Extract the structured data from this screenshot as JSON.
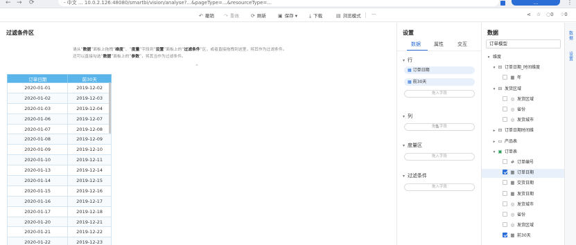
{
  "browser": {
    "address": "- 中文 ... 10.0.2.126:48080/smartbi/vision/analyse?...&pageType=...&resourceType=...",
    "account": "..."
  },
  "toolbar": {
    "undo": "撤销",
    "redo": "重做",
    "refresh": "刷新",
    "save": "保存",
    "download": "下载",
    "browse": "浏览模式",
    "more": "···",
    "comments": "0",
    "likes": "0"
  },
  "canvas": {
    "title": "过滤条件区",
    "hint_line1": {
      "p1": "请从“",
      "k1": "数据",
      "p2": "”面板上拖拽“",
      "k2": "维度",
      "p3": "”、“",
      "k3": "度量",
      "p4": "”字段到“",
      "k4": "设置",
      "p5": "”面板上的“",
      "k5": "过滤条件",
      "p6": "”区，或者直接拖拽到这里，将其作为过滤条件。"
    },
    "hint_line2": {
      "p1": "还可以直接勾选“",
      "k1": "数据",
      "p2": "”面板上的“",
      "k2": "参数",
      "p3": "”，将其当作为过滤条件。"
    }
  },
  "table": {
    "headers": [
      "订单日期",
      "前30天"
    ],
    "rows": [
      [
        "2020-01-01",
        "2019-12-02"
      ],
      [
        "2020-01-02",
        "2019-12-03"
      ],
      [
        "2020-01-03",
        "2019-12-04"
      ],
      [
        "2020-01-06",
        "2019-12-07"
      ],
      [
        "2020-01-07",
        "2019-12-08"
      ],
      [
        "2020-01-08",
        "2019-12-09"
      ],
      [
        "2020-01-09",
        "2019-12-10"
      ],
      [
        "2020-01-10",
        "2019-12-11"
      ],
      [
        "2020-01-13",
        "2019-12-14"
      ],
      [
        "2020-01-14",
        "2019-12-15"
      ],
      [
        "2020-01-15",
        "2019-12-16"
      ],
      [
        "2020-01-16",
        "2019-12-17"
      ],
      [
        "2020-01-17",
        "2019-12-18"
      ],
      [
        "2020-01-20",
        "2019-12-21"
      ],
      [
        "2020-01-21",
        "2019-12-22"
      ],
      [
        "2020-01-22",
        "2019-12-23"
      ]
    ]
  },
  "settings": {
    "title": "设置",
    "tabs": [
      "数据",
      "属性",
      "交互"
    ],
    "rows_section": "行",
    "row_chip_1": "订单日期",
    "row_chip_2": "前30天",
    "drop_hint": "拖入字段",
    "cols_section": "列",
    "measure_section": "度量区",
    "filter_section": "过滤条件"
  },
  "data": {
    "title": "数据",
    "model": "订单模型",
    "tree": [
      {
        "label": "维度",
        "level": 0,
        "arrow": "▾",
        "icon": "",
        "cb": "",
        "key": "dim"
      },
      {
        "label": "订单日期_时间维度",
        "level": 1,
        "arrow": "▾",
        "icon": "hier",
        "cb": "",
        "key": "t1"
      },
      {
        "label": "年",
        "level": 2,
        "arrow": "",
        "icon": "cal",
        "cb": "off",
        "key": "t2"
      },
      {
        "label": "发货区域",
        "level": 1,
        "arrow": "▾",
        "icon": "hier",
        "cb": "",
        "key": "t3"
      },
      {
        "label": "发货区域",
        "level": 2,
        "arrow": "",
        "icon": "globe",
        "cb": "off",
        "key": "t4"
      },
      {
        "label": "省份",
        "level": 2,
        "arrow": "",
        "icon": "globe",
        "cb": "off",
        "key": "t5"
      },
      {
        "label": "发货城市",
        "level": 2,
        "arrow": "",
        "icon": "globe",
        "cb": "off",
        "key": "t6"
      },
      {
        "label": "订单日期时间维",
        "level": 1,
        "arrow": "▸",
        "icon": "hier",
        "cb": "",
        "key": "t7"
      },
      {
        "label": "产品表",
        "level": 1,
        "arrow": "▸",
        "icon": "folder",
        "cb": "",
        "key": "t8"
      },
      {
        "label": "订单表",
        "level": 1,
        "arrow": "▾",
        "icon": "tableg",
        "cb": "",
        "key": "t9"
      },
      {
        "label": "订单编号",
        "level": 2,
        "arrow": "",
        "icon": "hash",
        "cb": "off",
        "key": "t10"
      },
      {
        "label": "订单日期",
        "level": 2,
        "arrow": "",
        "icon": "cal",
        "cb": "on",
        "key": "t11"
      },
      {
        "label": "交货日期",
        "level": 2,
        "arrow": "",
        "icon": "cal",
        "cb": "off",
        "key": "t12"
      },
      {
        "label": "发货日期",
        "level": 2,
        "arrow": "",
        "icon": "cal",
        "cb": "off",
        "key": "t13"
      },
      {
        "label": "发货城市",
        "level": 2,
        "arrow": "",
        "icon": "globe",
        "cb": "off",
        "key": "t14"
      },
      {
        "label": "省份",
        "level": 2,
        "arrow": "",
        "icon": "globe",
        "cb": "off",
        "key": "t15"
      },
      {
        "label": "发货区域",
        "level": 2,
        "arrow": "",
        "icon": "globe",
        "cb": "off",
        "key": "t16"
      },
      {
        "label": "前30天",
        "level": 2,
        "arrow": "",
        "icon": "calc",
        "cb": "on",
        "key": "t17"
      }
    ]
  },
  "vstrip": {
    "tab1": "数据",
    "tab2": "设置"
  },
  "colors": {
    "accent": "#2b6fd6",
    "table_header": "#59b4ea"
  }
}
